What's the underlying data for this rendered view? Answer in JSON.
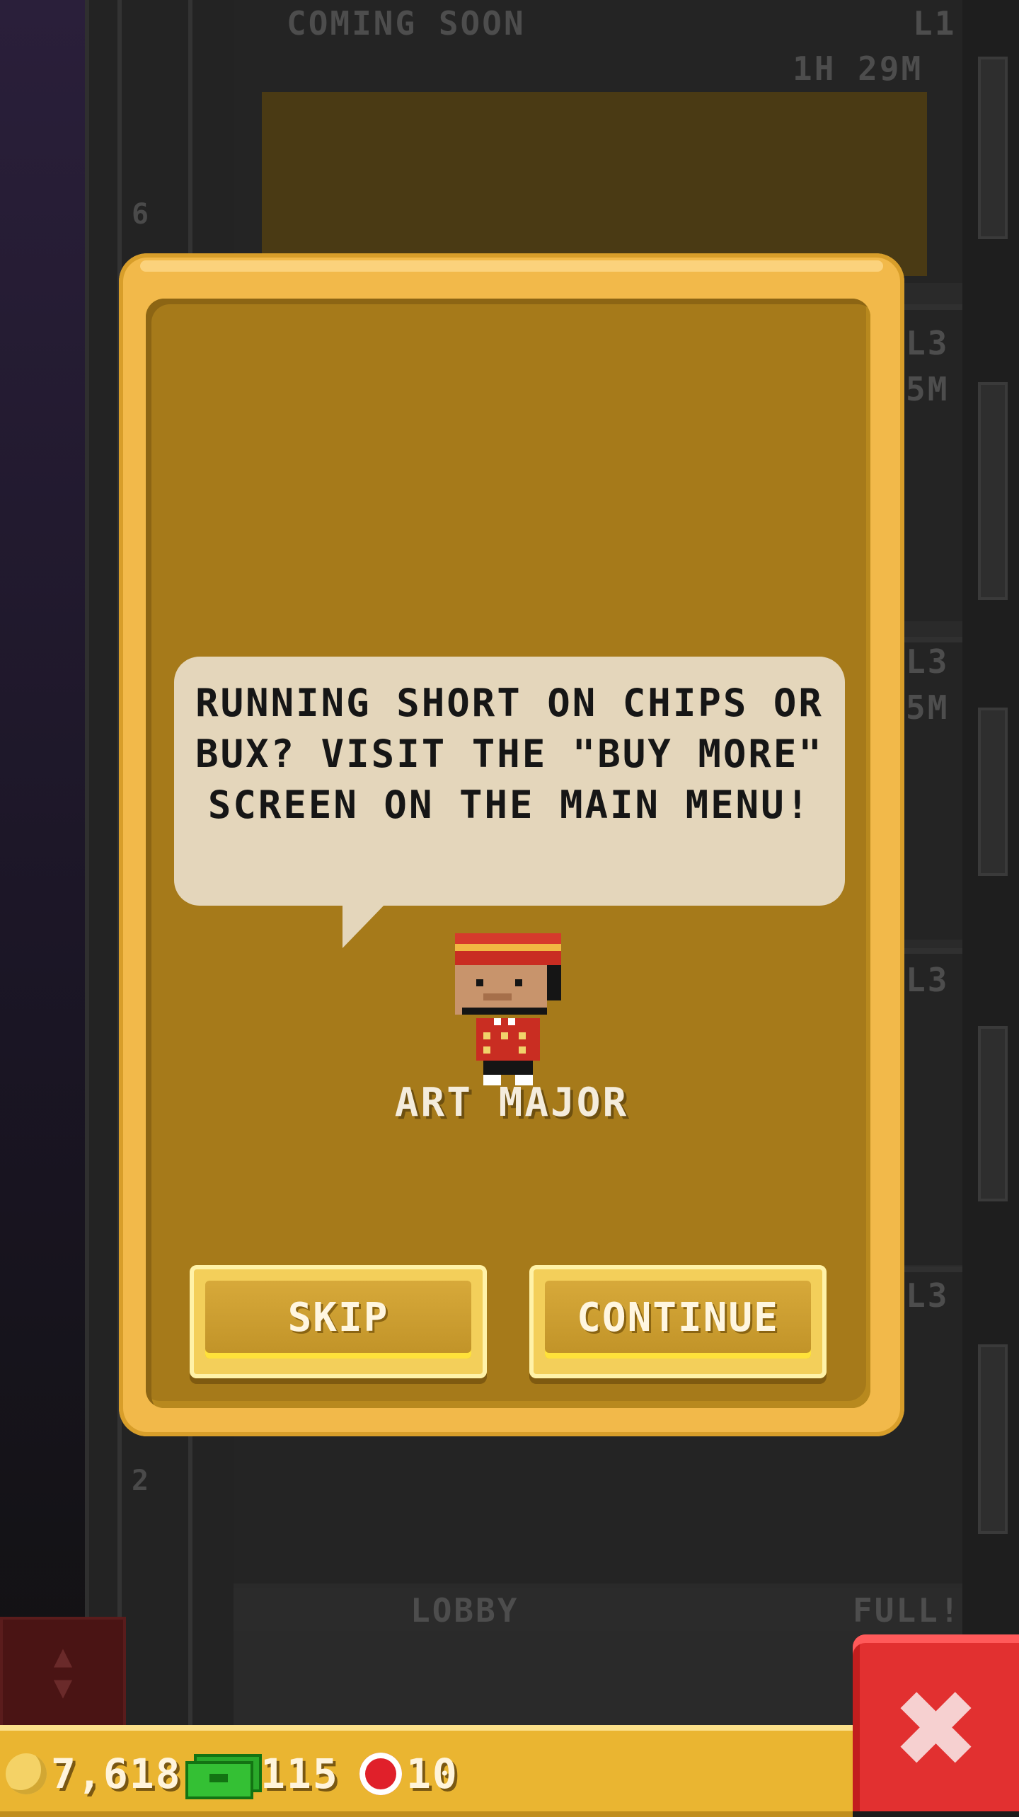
{
  "background": {
    "top_floor_label": "COMING SOON",
    "top_floor_level": "L1",
    "top_floor_timer": "1H 29M",
    "side_labels": [
      "L3",
      "5M",
      "L3",
      "5M",
      "L3",
      "L3"
    ],
    "elevator_floor_numbers": [
      "6",
      "2"
    ],
    "lobby_label": "LOBBY",
    "lobby_status": "FULL!"
  },
  "dialog": {
    "message": "RUNNING SHORT ON CHIPS OR BUX? VISIT THE \"BUY MORE\" SCREEN ON THE MAIN MENU!",
    "character_name": "ART MAJOR",
    "skip_label": "SKIP",
    "continue_label": "CONTINUE"
  },
  "bottom_bar": {
    "coins": "7,618",
    "bux": "115",
    "chips": "10",
    "close_icon": "close-x-icon"
  },
  "colors": {
    "dialog_frame": "#f2b94a",
    "dialog_inner": "#a67a1a",
    "bubble": "#e4d6bb",
    "close_button": "#e23030",
    "bottom_bar": "#eab531"
  }
}
